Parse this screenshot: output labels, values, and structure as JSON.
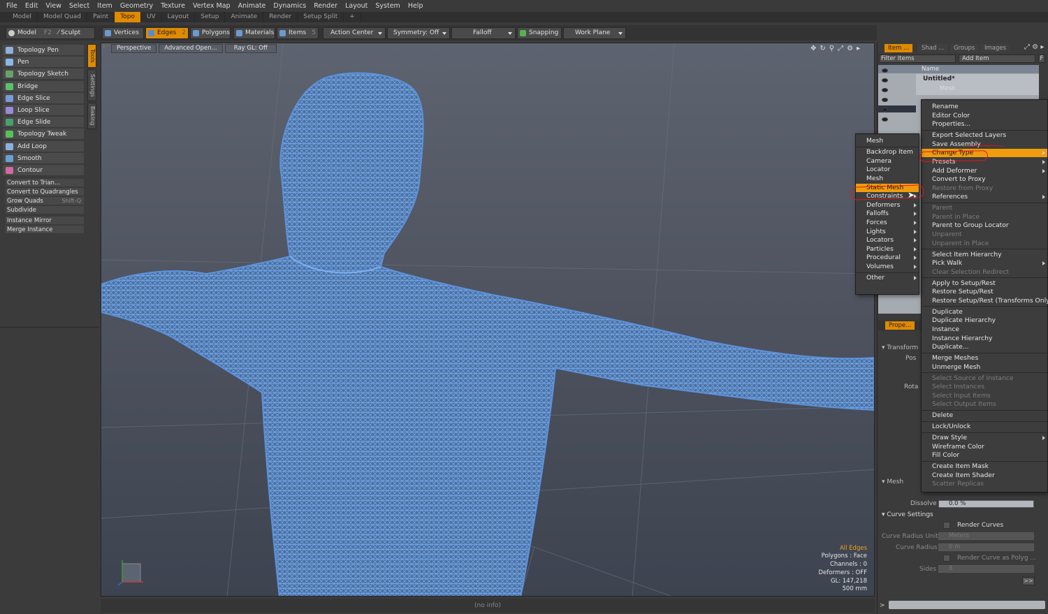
{
  "menubar": [
    "File",
    "Edit",
    "View",
    "Select",
    "Item",
    "Geometry",
    "Texture",
    "Vertex Map",
    "Animate",
    "Dynamics",
    "Render",
    "Layout",
    "System",
    "Help"
  ],
  "layout_tabs": [
    {
      "label": "Model",
      "active": false
    },
    {
      "label": "Model Quad",
      "active": false
    },
    {
      "label": "Paint",
      "active": false
    },
    {
      "label": "Topo",
      "active": true
    },
    {
      "label": "UV",
      "active": false
    },
    {
      "label": "Layout",
      "active": false
    },
    {
      "label": "Setup",
      "active": false
    },
    {
      "label": "Animate",
      "active": false
    },
    {
      "label": "Render",
      "active": false
    },
    {
      "label": "Setup Split",
      "active": false
    },
    {
      "label": "+",
      "active": false
    }
  ],
  "toolbar": {
    "model": "Model",
    "model_key": "F2",
    "sculpt": "Sculpt",
    "vertices": "Vertices",
    "edges": "Edges",
    "edges_count": "2",
    "polygons": "Polygons",
    "materials": "Materials",
    "items": "Items",
    "items_count": "5",
    "action_center": "Action Center",
    "symmetry": "Symmetry: Off",
    "falloff": "Falloff",
    "snapping": "Snapping",
    "work_plane": "Work Plane"
  },
  "tools": [
    "Topology Pen",
    "Pen",
    "Topology Sketch",
    "Bridge",
    "Edge Slice",
    "Loop Slice",
    "Edge Slide",
    "Topology Tweak",
    "Add Loop",
    "Smooth",
    "Contour"
  ],
  "commands": [
    {
      "label": "Convert to Trian...",
      "shortcut": ""
    },
    {
      "label": "Convert to Quadrangles",
      "shortcut": ""
    },
    {
      "label": "Grow Quads",
      "shortcut": "Shift-Q"
    },
    {
      "label": "Subdivide",
      "shortcut": ""
    },
    {
      "label": "Instance Mirror",
      "shortcut": ""
    },
    {
      "label": "Merge Instance",
      "shortcut": ""
    }
  ],
  "side_tabs": [
    "Tools",
    "Settings",
    "Baking"
  ],
  "viewport": {
    "buttons": [
      "Perspective",
      "Advanced Open...",
      "Ray GL: Off"
    ],
    "stats": {
      "selection": "All Edges",
      "polygons": "Polygons : Face",
      "channels": "Channels : 0",
      "deformers": "Deformers : OFF",
      "gl": "GL: 147,218",
      "scale": "500 mm"
    }
  },
  "status": "(no info)",
  "right_panel": {
    "tabs": [
      "Item ...",
      "Shad ...",
      "Groups",
      "Images"
    ],
    "filter_placeholder": "Filter Items",
    "add_item": "Add Item",
    "f_button": "F",
    "name_header": "Name",
    "scene_name": "Untitled*",
    "mesh_item": "Mesh",
    "props_tab": "Prope...",
    "transform": "Transform",
    "pos": "Pos",
    "rot": "Rota",
    "mesh_section": "Mesh",
    "dissolve_label": "Dissolve",
    "dissolve_value": "0.0 %",
    "curve_settings": "Curve Settings",
    "render_curves": "Render Curves",
    "curve_radius_unit_label": "Curve Radius Unit",
    "curve_radius_unit": "Meters",
    "curve_radius_label": "Curve Radius",
    "curve_radius": "0 m",
    "render_curve_polyg": "Render Curve as Polyg ...",
    "sides_label": "Sides",
    "sides": "8",
    "more_button": ">>",
    "bottom_prompt": ">"
  },
  "context_menu": [
    {
      "label": "Rename",
      "state": "normal",
      "sub": false
    },
    {
      "label": "Editor Color",
      "state": "normal",
      "sub": false
    },
    {
      "label": "Properties...",
      "state": "normal",
      "sub": false
    },
    {
      "sep": true
    },
    {
      "label": "Export Selected Layers",
      "state": "normal",
      "sub": false
    },
    {
      "label": "Save Assembly",
      "state": "normal",
      "sub": false
    },
    {
      "label": "Change Type",
      "state": "highlight",
      "sub": true
    },
    {
      "label": "Presets",
      "state": "normal",
      "sub": true
    },
    {
      "label": "Add Deformer",
      "state": "normal",
      "sub": true
    },
    {
      "label": "Convert to Proxy",
      "state": "normal",
      "sub": false
    },
    {
      "label": "Restore from Proxy",
      "state": "disabled",
      "sub": false
    },
    {
      "label": "References",
      "state": "normal",
      "sub": true
    },
    {
      "sep": true
    },
    {
      "label": "Parent",
      "state": "disabled",
      "sub": false
    },
    {
      "label": "Parent in Place",
      "state": "disabled",
      "sub": false
    },
    {
      "label": "Parent to Group Locator",
      "state": "normal",
      "sub": false
    },
    {
      "label": "Unparent",
      "state": "disabled",
      "sub": false
    },
    {
      "label": "Unparent in Place",
      "state": "disabled",
      "sub": false
    },
    {
      "sep": true
    },
    {
      "label": "Select Item Hierarchy",
      "state": "normal",
      "sub": false
    },
    {
      "label": "Pick Walk",
      "state": "normal",
      "sub": true
    },
    {
      "label": "Clear Selection Redirect",
      "state": "disabled",
      "sub": false
    },
    {
      "sep": true
    },
    {
      "label": "Apply to Setup/Rest",
      "state": "normal",
      "sub": false
    },
    {
      "label": "Restore Setup/Rest",
      "state": "normal",
      "sub": false
    },
    {
      "label": "Restore Setup/Rest (Transforms Only)",
      "state": "normal",
      "sub": false
    },
    {
      "sep": true
    },
    {
      "label": "Duplicate",
      "state": "normal",
      "sub": false
    },
    {
      "label": "Duplicate Hierarchy",
      "state": "normal",
      "sub": false
    },
    {
      "label": "Instance",
      "state": "normal",
      "sub": false
    },
    {
      "label": "Instance Hierarchy",
      "state": "normal",
      "sub": false
    },
    {
      "label": "Duplicate...",
      "state": "normal",
      "sub": false
    },
    {
      "sep": true
    },
    {
      "label": "Merge Meshes",
      "state": "normal",
      "sub": false
    },
    {
      "label": "Unmerge Mesh",
      "state": "normal",
      "sub": false
    },
    {
      "sep": true
    },
    {
      "label": "Select Source of Instance",
      "state": "disabled",
      "sub": false
    },
    {
      "label": "Select Instances",
      "state": "disabled",
      "sub": false
    },
    {
      "label": "Select Input Items",
      "state": "disabled",
      "sub": false
    },
    {
      "label": "Select Output Items",
      "state": "disabled",
      "sub": false
    },
    {
      "sep": true
    },
    {
      "label": "Delete",
      "state": "normal",
      "sub": false
    },
    {
      "sep": true
    },
    {
      "label": "Lock/Unlock",
      "state": "normal",
      "sub": false
    },
    {
      "sep": true
    },
    {
      "label": "Draw Style",
      "state": "normal",
      "sub": true
    },
    {
      "label": "Wireframe Color",
      "state": "normal",
      "sub": false
    },
    {
      "label": "Fill Color",
      "state": "normal",
      "sub": false
    },
    {
      "sep": true
    },
    {
      "label": "Create Item Mask",
      "state": "normal",
      "sub": false
    },
    {
      "label": "Create Item Shader",
      "state": "normal",
      "sub": false
    },
    {
      "label": "Scatter Replicas",
      "state": "disabled",
      "sub": false
    }
  ],
  "submenu": [
    {
      "label": "Mesh",
      "state": "normal",
      "sub": false
    },
    {
      "sep": true
    },
    {
      "label": "Backdrop Item",
      "state": "normal",
      "sub": false
    },
    {
      "label": "Camera",
      "state": "normal",
      "sub": false
    },
    {
      "label": "Locator",
      "state": "normal",
      "sub": false
    },
    {
      "label": "Mesh",
      "state": "normal",
      "sub": false
    },
    {
      "label": "Static Mesh",
      "state": "highlight",
      "sub": false
    },
    {
      "label": "Constraints",
      "state": "normal",
      "sub": true
    },
    {
      "label": "Deformers",
      "state": "normal",
      "sub": true
    },
    {
      "label": "Falloffs",
      "state": "normal",
      "sub": true
    },
    {
      "label": "Forces",
      "state": "normal",
      "sub": true
    },
    {
      "label": "Lights",
      "state": "normal",
      "sub": true
    },
    {
      "label": "Locators",
      "state": "normal",
      "sub": true
    },
    {
      "label": "Particles",
      "state": "normal",
      "sub": true
    },
    {
      "label": "Procedural",
      "state": "normal",
      "sub": true
    },
    {
      "label": "Volumes",
      "state": "normal",
      "sub": true
    },
    {
      "sep": true
    },
    {
      "label": "Other",
      "state": "normal",
      "sub": true
    }
  ],
  "colors": {
    "accent": "#e08a00",
    "menu_highlight": "#f09c0c",
    "wire": "#4a86d8",
    "annotation": "#e21818"
  },
  "icons": {
    "tool": "tool-icon",
    "eye": "eye-icon",
    "axis": "axis-gizmo-icon",
    "cursor": "mouse-cursor-icon"
  }
}
